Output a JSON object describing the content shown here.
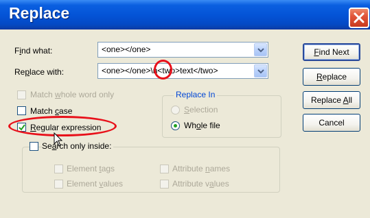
{
  "window": {
    "title": "Replace",
    "close_icon": "close-icon"
  },
  "find": {
    "label_pre": "F",
    "label_u": "i",
    "label_post": "nd what:",
    "value": "<one></one>"
  },
  "replace": {
    "label_pre": "Re",
    "label_u": "p",
    "label_post": "lace with:",
    "value": "<one></one>\\n<two>text</two>"
  },
  "options": {
    "whole_word": {
      "pre": "Match ",
      "u": "w",
      "post": "hole word only",
      "checked": false,
      "enabled": false
    },
    "match_case": {
      "pre": "Match ",
      "u": "c",
      "post": "ase",
      "checked": false,
      "enabled": true
    },
    "regex": {
      "pre": "",
      "u": "R",
      "post": "egular expression",
      "checked": true,
      "enabled": true
    },
    "search_inside": {
      "pre": "Se",
      "u": "a",
      "post": "rch only inside:",
      "checked": false,
      "enabled": true
    }
  },
  "replace_in": {
    "title": "Replace In",
    "selection": {
      "pre": "",
      "u": "S",
      "post": "election",
      "selected": false,
      "enabled": false
    },
    "whole_file": {
      "pre": "Wh",
      "u": "o",
      "post": "le file",
      "selected": true,
      "enabled": true
    }
  },
  "search_inside_opts": {
    "element_tags": {
      "pre": "Element ",
      "u": "t",
      "post": "ags"
    },
    "element_values": {
      "pre": "Element ",
      "u": "v",
      "post": "alues"
    },
    "attribute_names": {
      "pre": "Attribute ",
      "u": "n",
      "post": "ames"
    },
    "attribute_values": {
      "pre": "Attribute v",
      "u": "a",
      "post": "lues"
    }
  },
  "buttons": {
    "find_next": {
      "u": "F",
      "post": "ind Next"
    },
    "replace": {
      "u": "R",
      "post": "eplace"
    },
    "replace_all": {
      "pre": "Replace ",
      "u": "A",
      "post": "ll"
    },
    "cancel": {
      "label": "Cancel"
    }
  },
  "colors": {
    "titlebar": "#0453d6",
    "highlight": "#e8101a",
    "check": "#21a121"
  }
}
